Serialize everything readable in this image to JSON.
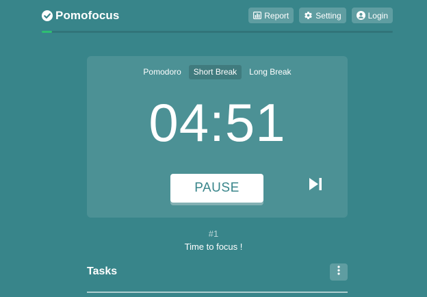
{
  "app": {
    "name": "Pomofocus",
    "logo_icon": "check-circle-icon"
  },
  "nav": {
    "report": {
      "label": "Report",
      "icon": "chart-icon"
    },
    "setting": {
      "label": "Setting",
      "icon": "gear-icon"
    },
    "login": {
      "label": "Login",
      "icon": "user-circle-icon"
    }
  },
  "progress": {
    "value_percent": 3,
    "color": "#2fbf71"
  },
  "timer": {
    "modes": [
      {
        "label": "Pomodoro",
        "active": false
      },
      {
        "label": "Short Break",
        "active": true
      },
      {
        "label": "Long Break",
        "active": false
      }
    ],
    "time": "04:51",
    "pause_label": "PAUSE",
    "skip_icon": "skip-next-icon"
  },
  "session": {
    "count": "#1",
    "message": "Time to focus !"
  },
  "tasks": {
    "title": "Tasks",
    "menu_icon": "kebab-menu-icon"
  },
  "colors": {
    "background": "#38858a",
    "accent": "#38858a",
    "progress": "#2fbf71"
  }
}
